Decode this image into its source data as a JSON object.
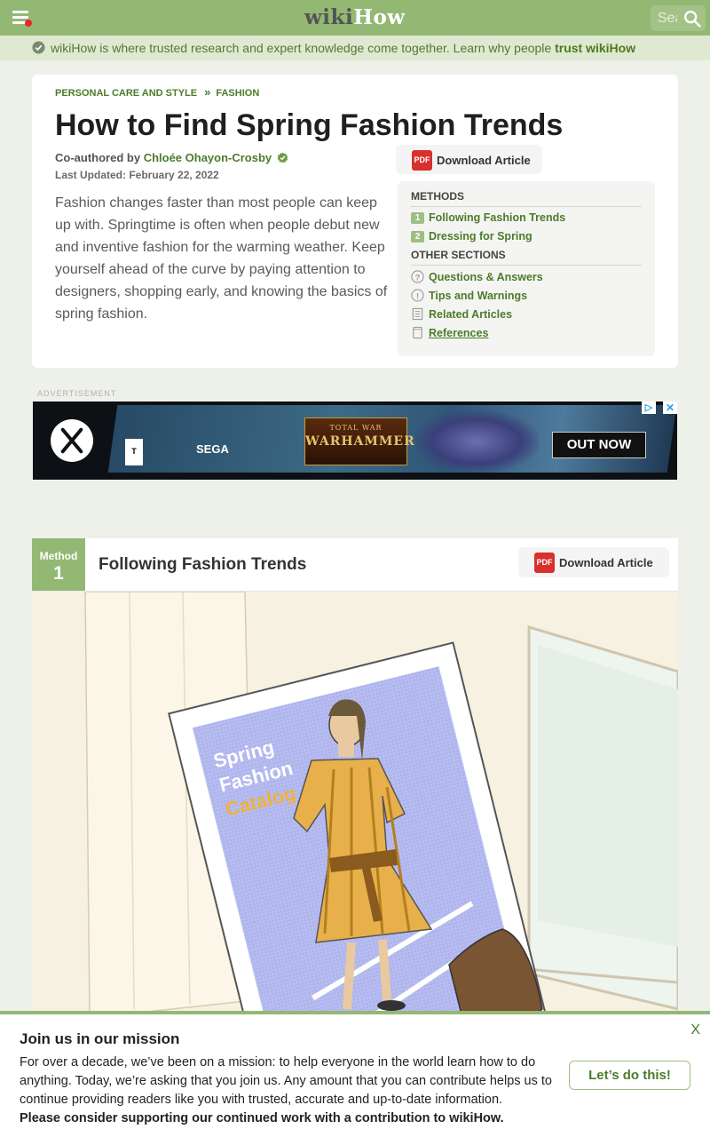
{
  "header": {
    "logo_wiki": "wiki",
    "logo_how": "How",
    "search_placeholder": "Search"
  },
  "trust_banner": {
    "text": "wikiHow is where trusted research and expert knowledge come together. Learn why people ",
    "link": "trust wikiHow"
  },
  "article": {
    "breadcrumb": [
      "PERSONAL CARE AND STYLE",
      "FASHION"
    ],
    "breadcrumb_sep": "»",
    "title": "How to Find Spring Fashion Trends",
    "coauthored_prefix": "Co-authored by",
    "author": "Chloée Ohayon-Crosby",
    "last_updated": "Last Updated: February 22, 2022",
    "intro": "Fashion changes faster than most people can keep up with. Springtime is often when people debut new and inventive fashion for the warming weather. Keep yourself ahead of the curve by paying attention to designers, shopping early, and knowing the basics of spring fashion.",
    "download_label": "Download Article",
    "pdf_icon_text": "PDF"
  },
  "toc": {
    "methods_heading": "METHODS",
    "methods": [
      {
        "num": "1",
        "label": "Following Fashion Trends"
      },
      {
        "num": "2",
        "label": "Dressing for Spring"
      }
    ],
    "other_heading": "OTHER SECTIONS",
    "other": [
      {
        "label": "Questions & Answers",
        "icon": "question-icon"
      },
      {
        "label": "Tips and Warnings",
        "icon": "exclamation-icon"
      },
      {
        "label": "Related Articles",
        "icon": "document-icon"
      },
      {
        "label": "References",
        "icon": "page-icon"
      }
    ]
  },
  "ad": {
    "label": "ADVERTISEMENT",
    "rating": "T",
    "publisher": "SEGA",
    "game_small": "TOTAL WAR",
    "game_big": "WARHAMMER",
    "cta": "OUT NOW",
    "adchoices": "▷",
    "close": "✕"
  },
  "method": {
    "word": "Method",
    "number": "1",
    "title": "Following Fashion Trends",
    "download_label": "Download Article",
    "catalog_text": [
      "Spring",
      "Fashion",
      "Catalog"
    ]
  },
  "mission": {
    "heading": "Join us in our mission",
    "body": "For over a decade, we’ve been on a mission: to help everyone in the world learn how to do anything. Today, we’re asking that you join us. Any amount that you can contribute helps us to continue providing readers like you with trusted, accurate and up-to-date information.",
    "bold": "Please consider supporting our continued work with a contribution to wikiHow.",
    "cta": "Let’s do this!",
    "close": "X"
  },
  "colors": {
    "brand_green": "#93b874",
    "link_green": "#4d7b2a",
    "pdf_red": "#d8302c",
    "notification_red": "#e8262a"
  }
}
